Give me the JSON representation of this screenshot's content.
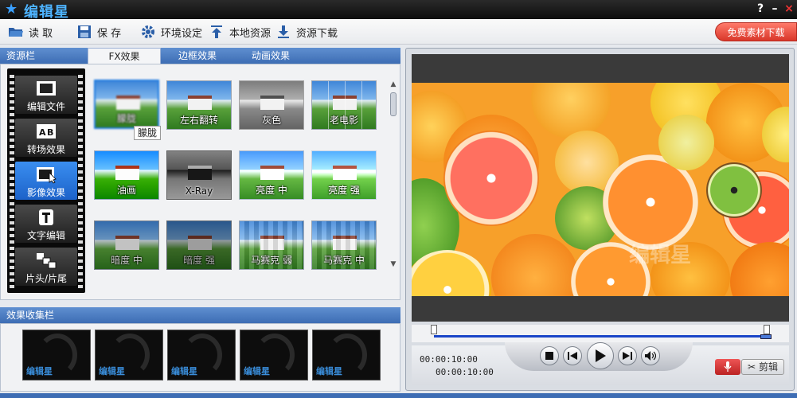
{
  "app": {
    "title": "编辑星"
  },
  "window_controls": {
    "help": "?",
    "minimize": "–",
    "close": "×"
  },
  "toolbar": {
    "read": "读 取",
    "save": "保 存",
    "settings": "环境设定",
    "local_resources": "本地资源",
    "download_resources": "资源下载",
    "promo": "免费素材下载"
  },
  "resource_panel": {
    "header": "资源栏",
    "tabs": [
      {
        "label": "FX效果",
        "active": true
      },
      {
        "label": "边框效果",
        "active": false
      },
      {
        "label": "动画效果",
        "active": false
      }
    ],
    "categories": [
      {
        "label": "编辑文件",
        "icon": "film-icon",
        "active": false
      },
      {
        "label": "转场效果",
        "icon": "ab-transition-icon",
        "active": false
      },
      {
        "label": "影像效果",
        "icon": "image-effect-icon",
        "active": true
      },
      {
        "label": "文字编辑",
        "icon": "text-icon",
        "active": false
      },
      {
        "label": "片头/片尾",
        "icon": "intro-outro-icon",
        "active": false
      }
    ],
    "effects": [
      {
        "label": "朦胧",
        "selected": true
      },
      {
        "label": "左右翻转",
        "selected": false
      },
      {
        "label": "灰色",
        "selected": false
      },
      {
        "label": "老电影",
        "selected": false
      },
      {
        "label": "油画",
        "selected": false
      },
      {
        "label": "X-Ray",
        "selected": false
      },
      {
        "label": "亮度 中",
        "selected": false
      },
      {
        "label": "亮度 强",
        "selected": false
      },
      {
        "label": "暗度 中",
        "selected": false
      },
      {
        "label": "暗度 强",
        "selected": false
      },
      {
        "label": "马赛克 弱",
        "selected": false
      },
      {
        "label": "马赛克 中",
        "selected": false
      }
    ],
    "tooltip": "朦胧"
  },
  "collection_panel": {
    "header": "效果收集栏",
    "slots": [
      {
        "logo": "编辑星"
      },
      {
        "logo": "编辑星"
      },
      {
        "logo": "编辑星"
      },
      {
        "logo": "编辑星"
      },
      {
        "logo": "编辑星"
      }
    ]
  },
  "preview": {
    "current_time": "00:00:10:00",
    "total_time": "00:00:10:00",
    "record_icon": "microphone-icon",
    "cut_label": "剪辑",
    "watermark": "编辑星"
  },
  "colors": {
    "accent": "#3d6db4",
    "title_blue": "#4db3ff",
    "promo_red": "#d9372a",
    "selection_blue": "#1e7be0"
  }
}
